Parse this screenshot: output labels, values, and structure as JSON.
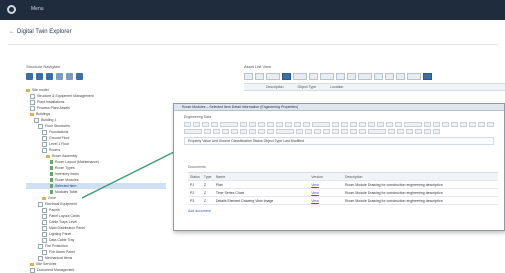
{
  "header": {
    "menu_label": "Menu"
  },
  "page": {
    "crumb": "←",
    "title": "Digital Twin Explorer"
  },
  "left_panel": {
    "title": "Structure Navigator",
    "tree": [
      {
        "label": "Site model",
        "kind": "fold"
      },
      {
        "label": "Structure & Equipment Management",
        "kind": "box"
      },
      {
        "label": "Plant Installations",
        "kind": "box"
      },
      {
        "label": "Process Plant Assets",
        "kind": "box"
      },
      {
        "label": "Buildings",
        "kind": "fold"
      },
      {
        "label": "Building 1",
        "kind": "box"
      },
      {
        "label": "Floor Structures",
        "kind": "box"
      },
      {
        "label": "Foundations",
        "kind": "box"
      },
      {
        "label": "Ground Floor",
        "kind": "box"
      },
      {
        "label": "Level 1 Floor",
        "kind": "box"
      },
      {
        "label": "Rooms",
        "kind": "box"
      },
      {
        "label": "Room Assembly",
        "kind": "fold"
      },
      {
        "label": "Room Layout (Maintenance)",
        "kind": "doc"
      },
      {
        "label": "Room Types",
        "kind": "doc"
      },
      {
        "label": "Inventory Items",
        "kind": "doc"
      },
      {
        "label": "Room Modules",
        "kind": "doc"
      },
      {
        "label": "Selected Item",
        "kind": "doc",
        "selected": true
      },
      {
        "label": "Modules Table",
        "kind": "doc"
      },
      {
        "label": "Zone",
        "kind": "fold"
      },
      {
        "label": "Electrical Equipment",
        "kind": "box"
      },
      {
        "label": "Panels",
        "kind": "box"
      },
      {
        "label": "Panel Layout Cards",
        "kind": "box"
      },
      {
        "label": "Cable Trays Level",
        "kind": "box"
      },
      {
        "label": "Main Distribution Panel",
        "kind": "box"
      },
      {
        "label": "Lighting Panel",
        "kind": "box"
      },
      {
        "label": "Data Cable Tray",
        "kind": "box"
      },
      {
        "label": "Fire Protection",
        "kind": "box"
      },
      {
        "label": "Fire Alarm Panel",
        "kind": "box"
      },
      {
        "label": "Mechanical Items",
        "kind": "box"
      },
      {
        "label": "Site Services",
        "kind": "fold"
      },
      {
        "label": "Document Management",
        "kind": "box"
      }
    ]
  },
  "right_panel": {
    "title": "Asset List View",
    "columns": [
      "Description",
      "Object Type",
      "Location"
    ]
  },
  "popup": {
    "title": "Room Modules – Selected Item Detail Information (Engineering Properties)",
    "subtitle": "Engineering Data",
    "properties_line": "Property   Value   Unit   Source   Classification   Status   Object Type   Last Modified",
    "section_label": "Documents",
    "table": {
      "headers": [
        "Status",
        "Type",
        "Name",
        "Version",
        "Description"
      ],
      "rows": [
        {
          "status": "P1",
          "type": "Z",
          "name": "Plan",
          "version": "View",
          "description": "Room Module Drawing for construction engineering description"
        },
        {
          "status": "P2",
          "type": "Z",
          "name": "Time Series Chart",
          "version": "View",
          "description": "Room Module Drawing for construction engineering description"
        },
        {
          "status": "P3",
          "type": "Z",
          "name": "Details Element Drawing View Image",
          "version": "View",
          "description": "Room Module Drawing for construction engineering description"
        }
      ],
      "footer": "Add document"
    }
  },
  "colors": {
    "topbar": "#1f2c3d",
    "accent": "#3b6fa3",
    "connector": "#3a9a6e"
  }
}
